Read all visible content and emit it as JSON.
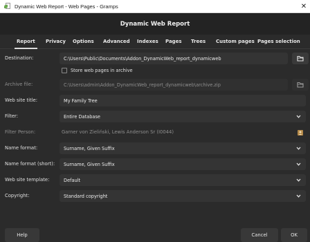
{
  "window": {
    "title": "Dynamic Web Report - Web Pages - Gramps",
    "close_glyph": "✕",
    "icon": "gramps-app-icon"
  },
  "dialog": {
    "title": "Dynamic Web Report"
  },
  "tabs": [
    {
      "label": "Report",
      "active": true
    },
    {
      "label": "Privacy",
      "active": false
    },
    {
      "label": "Options",
      "active": false
    },
    {
      "label": "Advanced",
      "active": false
    },
    {
      "label": "Indexes",
      "active": false
    },
    {
      "label": "Pages",
      "active": false
    },
    {
      "label": "Trees",
      "active": false
    },
    {
      "label": "Custom pages",
      "active": false
    },
    {
      "label": "Pages selection",
      "active": false
    }
  ],
  "form": {
    "destination": {
      "label": "Destination:",
      "value": "C:\\Users\\Public\\Documents\\Addon_DynamicWeb_report_dynamicweb",
      "button_icon": "folder-icon"
    },
    "archive_checkbox": {
      "label": "Store web pages in archive",
      "checked": false
    },
    "archive_file": {
      "label": "Archive file:",
      "value": "C:\\Users\\admin\\Addon_DynamicWeb_report_dynamicweb\\archive.zip",
      "button_icon": "folder-icon",
      "enabled": false
    },
    "site_title": {
      "label": "Web site title:",
      "value": "My Family Tree"
    },
    "filter": {
      "label": "Filter:",
      "value": "Entire Database"
    },
    "filter_person": {
      "label": "Filter Person:",
      "value": "Garner von Zieliński, Lewis Anderson Sr (I0044)",
      "button_icon": "person-select-icon",
      "enabled": false
    },
    "name_format": {
      "label": "Name format:",
      "value": "Surname, Given Suffix"
    },
    "name_format_short": {
      "label": "Name format (short):",
      "value": "Surname, Given Suffix"
    },
    "template": {
      "label": "Web site template:",
      "value": "Default"
    },
    "copyright": {
      "label": "Copyright:",
      "value": "Standard copyright"
    }
  },
  "buttons": {
    "help": "Help",
    "cancel": "Cancel",
    "ok": "OK"
  }
}
